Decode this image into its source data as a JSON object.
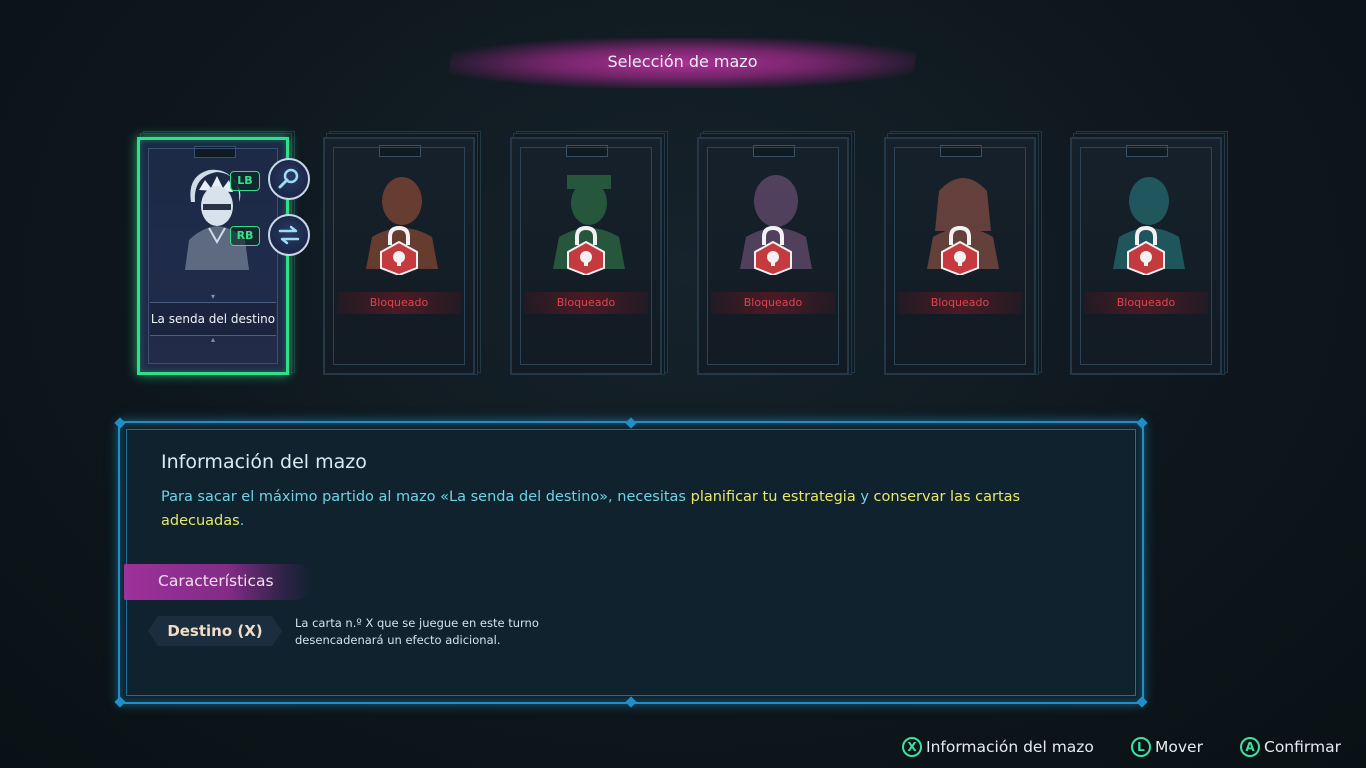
{
  "header": {
    "title": "Selección de mazo"
  },
  "decks": [
    {
      "name": "La senda del destino",
      "status": "",
      "selected": true,
      "tint": "#9fb2c6"
    },
    {
      "name": "",
      "status": "Bloqueado",
      "selected": false,
      "tint": "#c9623a"
    },
    {
      "name": "",
      "status": "Bloqueado",
      "selected": false,
      "tint": "#3c9a55"
    },
    {
      "name": "",
      "status": "Bloqueado",
      "selected": false,
      "tint": "#9a6a9c"
    },
    {
      "name": "",
      "status": "Bloqueado",
      "selected": false,
      "tint": "#c66a55"
    },
    {
      "name": "",
      "status": "Bloqueado",
      "selected": false,
      "tint": "#2e9a9c"
    }
  ],
  "card_buttons": {
    "lb_label": "LB",
    "rb_label": "RB",
    "inspect_icon": "magnifier-icon",
    "swap_icon": "swap-icon"
  },
  "info": {
    "title": "Información del mazo",
    "desc_part1": "Para sacar el máximo partido al mazo «La senda del destino», necesitas ",
    "desc_hl1": "planificar tu estrategia",
    "desc_part2": " y ",
    "desc_hl2": "conservar las cartas adecuadas",
    "desc_part3": ".",
    "characteristics_label": "Características",
    "keyword": "Destino (X)",
    "keyword_desc": "La carta n.º X que se juegue en este turno desencadenará un efecto adicional."
  },
  "hints": [
    {
      "button": "X",
      "label": "Información del mazo"
    },
    {
      "button": "L",
      "label": "Mover"
    },
    {
      "button": "A",
      "label": "Confirmar"
    }
  ],
  "colors": {
    "selected_border": "#2ee08a",
    "locked_text": "#e0434e",
    "panel_border": "#1e8fc7",
    "highlight": "#e6e86a",
    "accent_magenta": "#b5329c"
  }
}
